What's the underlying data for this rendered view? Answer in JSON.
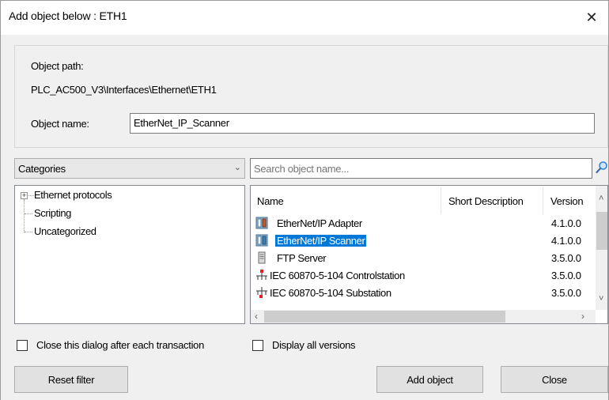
{
  "dialog": {
    "title": "Add object below : ETH1",
    "close_glyph": "✕"
  },
  "object": {
    "path_label": "Object path:",
    "path_value": "PLC_AC500_V3\\Interfaces\\Ethernet\\ETH1",
    "name_label": "Object name:",
    "name_value": "EtherNet_IP_Scanner"
  },
  "categories": {
    "selected": "Categories",
    "tree": [
      {
        "label": "Ethernet protocols",
        "expander": "+"
      },
      {
        "label": "Scripting"
      },
      {
        "label": "Uncategorized"
      }
    ]
  },
  "search": {
    "placeholder": "Search object name..."
  },
  "list": {
    "columns": [
      "Name",
      "Short Description",
      "Version"
    ],
    "rows": [
      {
        "name": "EtherNet/IP Adapter",
        "version": "4.1.0.0",
        "icon": "device-module-icon",
        "selected": false
      },
      {
        "name": "EtherNet/IP Scanner",
        "version": "4.1.0.0",
        "icon": "device-module-icon",
        "selected": true
      },
      {
        "name": "FTP Server",
        "version": "3.5.0.0",
        "icon": "server-icon",
        "selected": false
      },
      {
        "name": "IEC 60870-5-104 Controlstation",
        "version": "3.5.0.0",
        "icon": "network-node-icon",
        "selected": false
      },
      {
        "name": "IEC 60870-5-104 Substation",
        "version": "3.5.0.0",
        "icon": "network-node-icon",
        "selected": false
      }
    ]
  },
  "options": {
    "close_after_transaction": {
      "label": "Close this dialog after each transaction",
      "checked": false
    },
    "display_all_versions": {
      "label": "Display all versions",
      "checked": false
    }
  },
  "buttons": {
    "reset_filter": "Reset filter",
    "add_object": "Add object",
    "close": "Close"
  },
  "colors": {
    "selection": "#0078d7",
    "dialog_bg": "#f0f0f0"
  }
}
